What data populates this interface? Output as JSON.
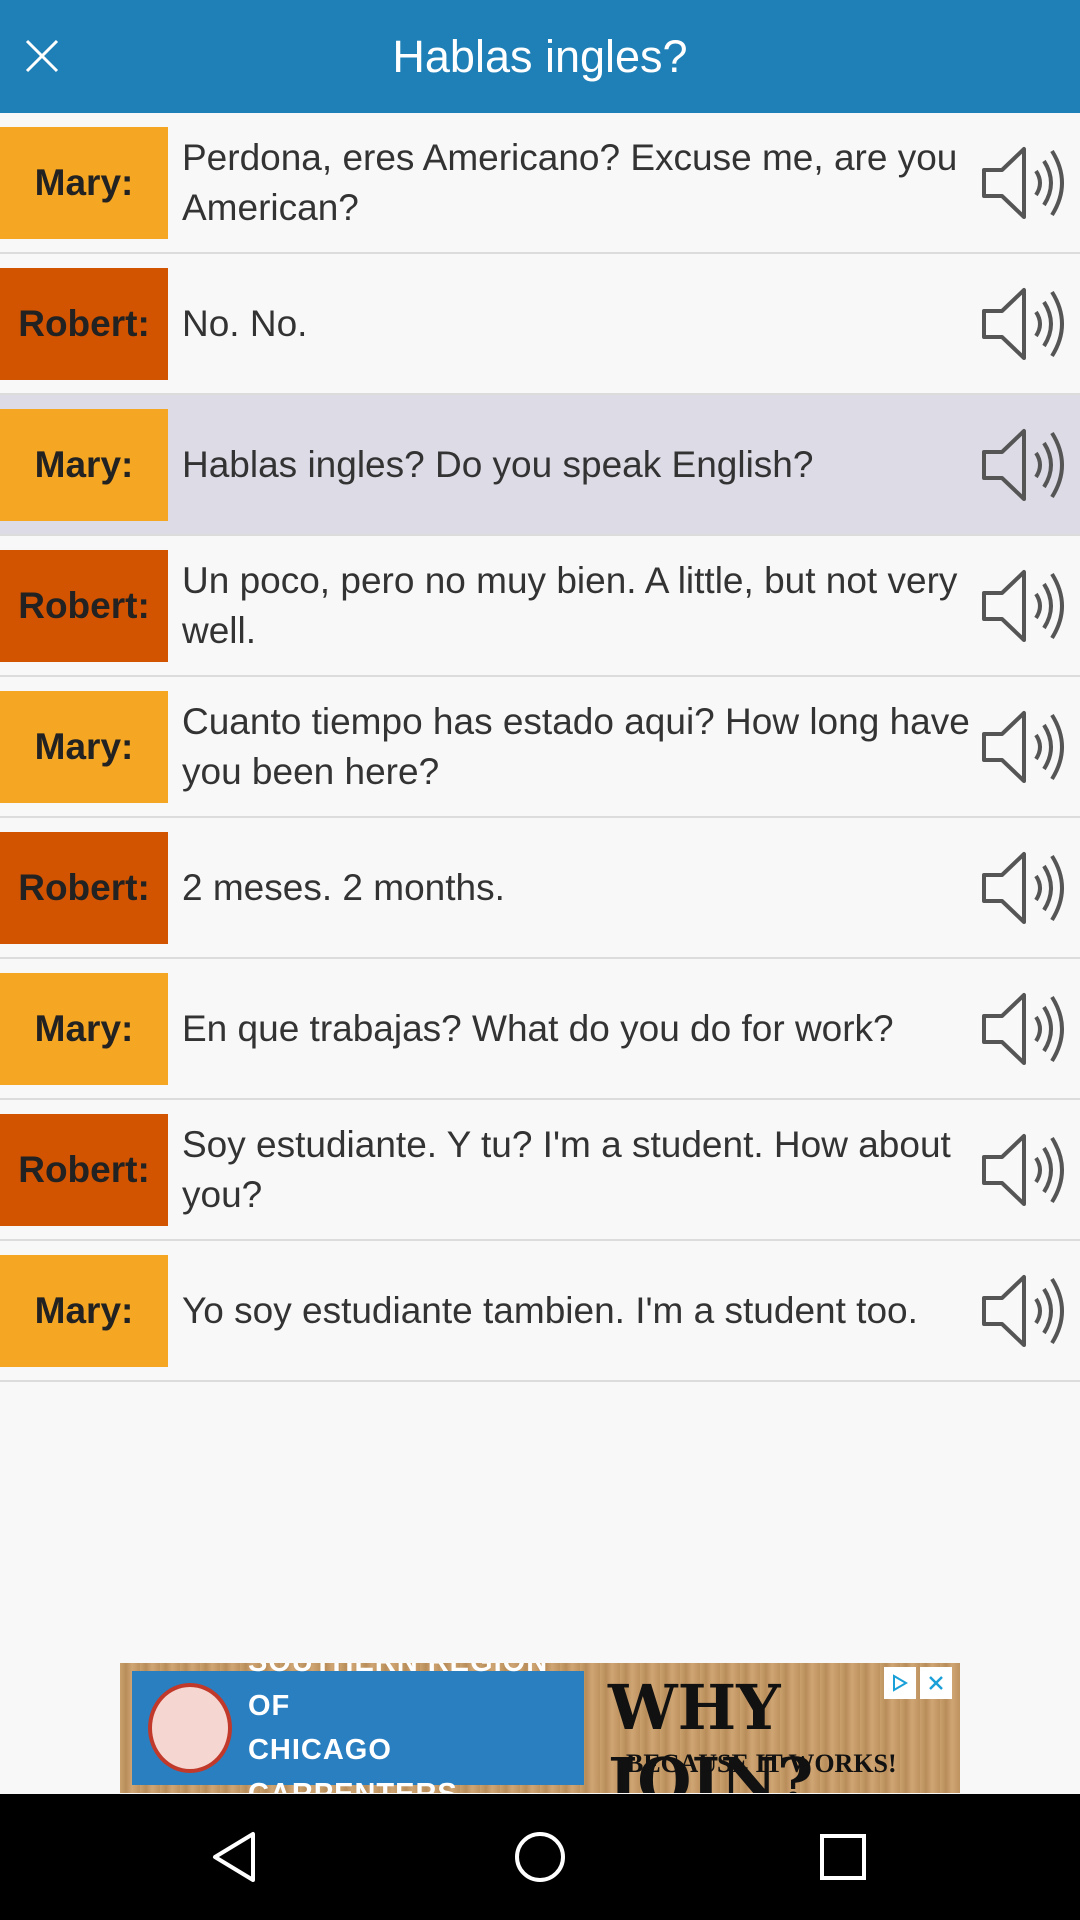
{
  "header": {
    "title": "Hablas ingles?",
    "close_icon": "close-icon",
    "background_color": "#1f80b7"
  },
  "colors": {
    "mary": "#f5a623",
    "robert": "#d25400",
    "highlight": "#dddbe6"
  },
  "dialogue": [
    {
      "speaker": "Mary:",
      "line": "Perdona, eres Americano? Excuse me, are you American?"
    },
    {
      "speaker": "Robert:",
      "line": "No. No."
    },
    {
      "speaker": "Mary:",
      "line": "Hablas ingles? Do you speak English?"
    },
    {
      "speaker": "Robert:",
      "line": "Un poco, pero no muy bien. A little, but not very well."
    },
    {
      "speaker": "Mary:",
      "line": "Cuanto tiempo has estado aqui? How long have you been here?"
    },
    {
      "speaker": "Robert:",
      "line": "2 meses. 2 months."
    },
    {
      "speaker": "Mary:",
      "line": "En que trabajas? What do you do for work?"
    },
    {
      "speaker": "Robert:",
      "line": "Soy estudiante. Y tu? I'm a student. How about you?"
    },
    {
      "speaker": "Mary:",
      "line": "Yo soy estudiante tambien. I'm a student too."
    }
  ],
  "ad": {
    "org_line1": "SOUTHERN REGION OF",
    "org_line2": "CHICAGO CARPENTERS",
    "headline": "WHY JOIN?",
    "tagline": "BECAUSE IT WORKS!"
  },
  "navbar": {
    "back_icon": "back-icon",
    "home_icon": "home-icon",
    "recents_icon": "recents-icon"
  }
}
